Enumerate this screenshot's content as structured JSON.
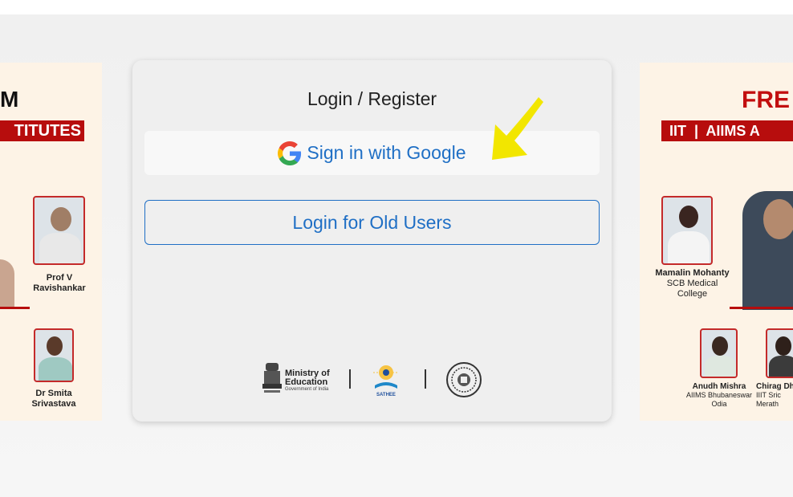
{
  "card": {
    "title": "Login / Register",
    "google_label": "Sign in with Google",
    "old_users_label": "Login for Old Users"
  },
  "logos": {
    "moe_line1": "Ministry of",
    "moe_line2": "Education",
    "moe_sub": "Government of India",
    "sathee_text": "SATHEE"
  },
  "banner_left": {
    "big_text": "M",
    "strip_text": "TITUTES",
    "person1_name_line1": "Prof V",
    "person1_name_line2": "Ravishankar",
    "person2_name_line1": "Dr Smita",
    "person2_name_line2": "Srivastava"
  },
  "banner_right": {
    "big_text": "FRE",
    "strip_text": "IIT  |  AIIMS A",
    "person1_name": "Mamalin Mohanty",
    "person1_org_line1": "SCB Medical",
    "person1_org_line2": "College",
    "person2_name": "Anudh Mishra",
    "person2_org_line1": "AIIMS Bhubaneswar",
    "person2_org_line2": "Odia",
    "person3_name": "Chirag Dh",
    "person3_org_line1": "IIIT Sric",
    "person3_org_line2": "Merath"
  },
  "colors": {
    "accent_blue": "#1f6fc5",
    "banner_red": "#b70d0d",
    "arrow_yellow": "#f2e600"
  },
  "icons": [
    "google-g-icon",
    "arrow-annotation-icon",
    "moe-emblem-icon",
    "sathee-logo-icon",
    "iitk-seal-icon"
  ]
}
